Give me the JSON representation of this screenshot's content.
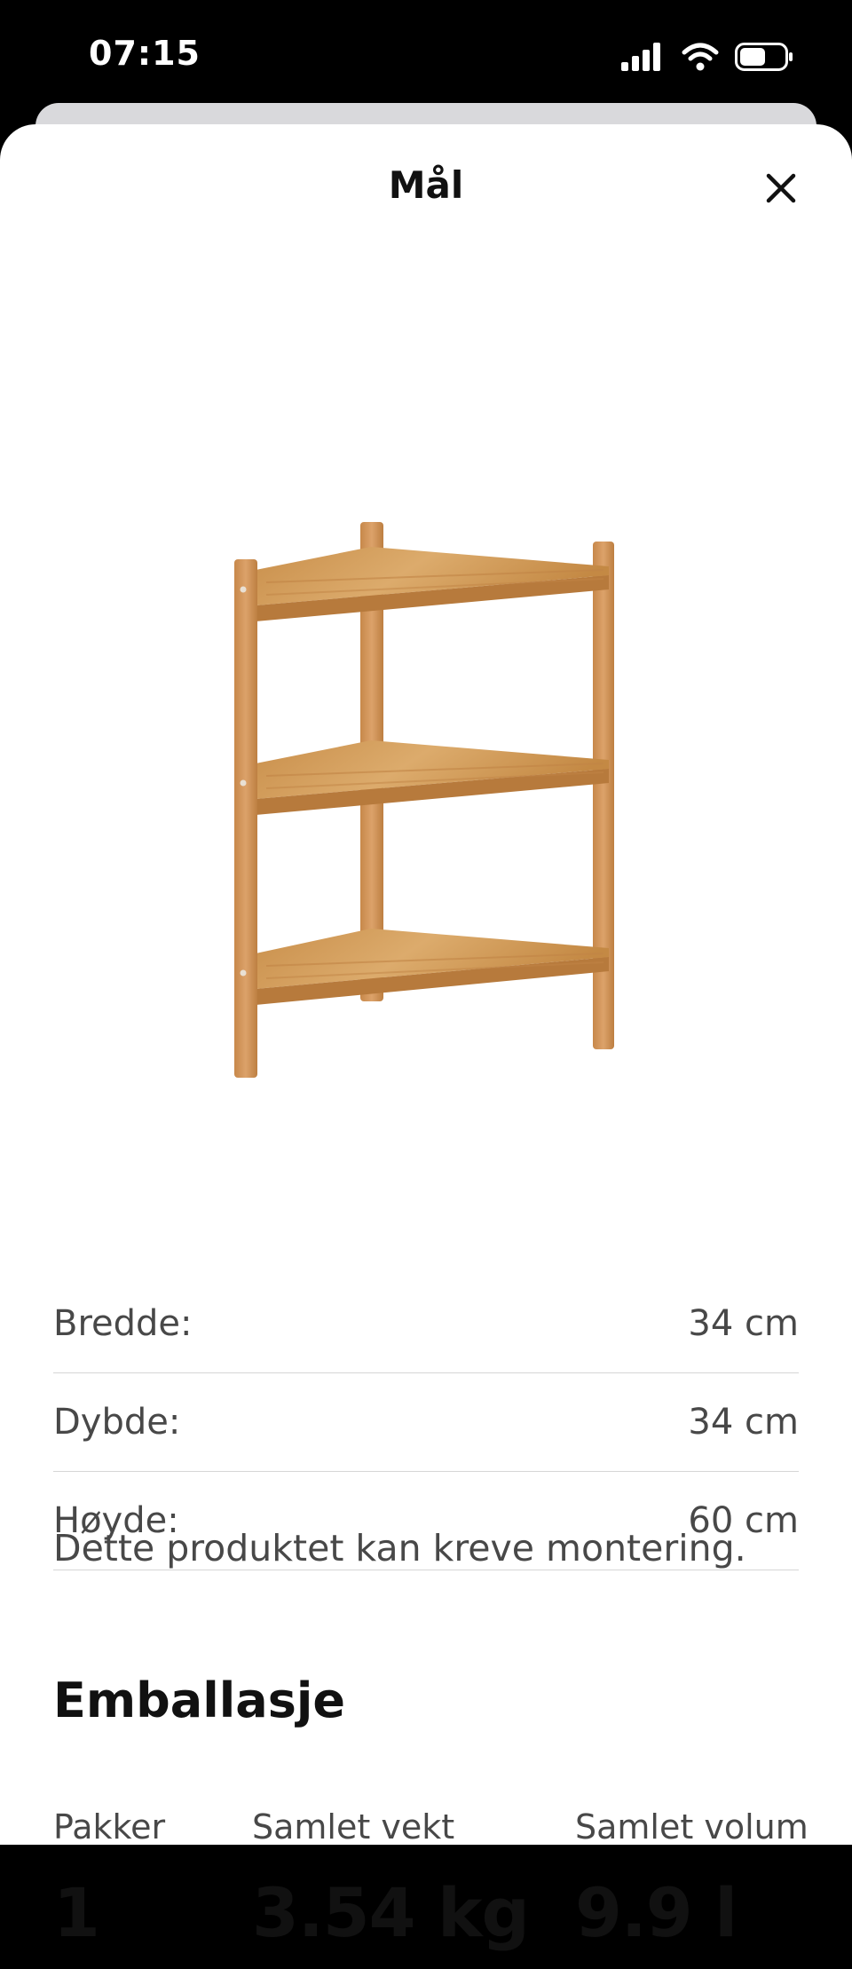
{
  "status_bar": {
    "time": "07:15",
    "signal_icon": "cellular-signal-icon",
    "wifi_icon": "wifi-icon",
    "battery_icon": "battery-icon"
  },
  "sheet": {
    "title": "Mål",
    "close_icon": "close-icon"
  },
  "product_image": {
    "icon": "corner-shelf-illustration",
    "wood_color": "#d29a55"
  },
  "dimensions": [
    {
      "label": "Bredde:",
      "value": "34 cm"
    },
    {
      "label": "Dybde:",
      "value": "34 cm"
    },
    {
      "label": "Høyde:",
      "value": "60 cm"
    }
  ],
  "assembly_note": "Dette produktet kan kreve montering.",
  "packaging": {
    "title": "Emballasje",
    "items": [
      {
        "label": "Pakker",
        "value": "1"
      },
      {
        "label": "Samlet vekt",
        "value": "3.54 kg"
      },
      {
        "label": "Samlet volum",
        "value": "9.9 l"
      }
    ]
  }
}
